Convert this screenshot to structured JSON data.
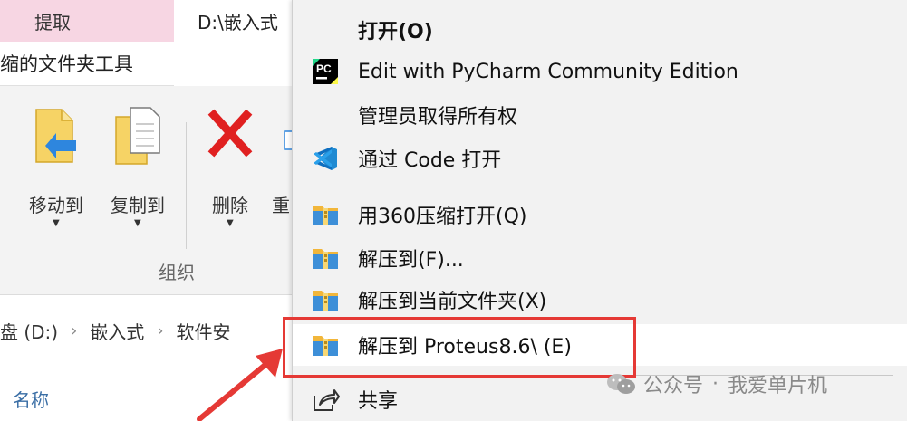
{
  "explorer": {
    "tab_extract": "提取",
    "tab_path": "D:\\嵌入式",
    "context_tools_label": "缩的文件夹工具",
    "ribbon": {
      "move_to": "移动到",
      "copy_to": "复制到",
      "delete": "删除",
      "rename_partial": "重",
      "group_label": "组织"
    },
    "address_bar": {
      "drive": "盘 (D:)",
      "crumb_1": "嵌入式",
      "crumb_2": "软件安"
    },
    "column_name": "名称"
  },
  "context_menu": {
    "items": [
      {
        "label": "打开(O)",
        "icon": "none",
        "bold": true
      },
      {
        "label": "Edit with PyCharm Community Edition",
        "icon": "pycharm-icon"
      },
      {
        "label": "管理员取得所有权",
        "icon": "none"
      },
      {
        "label": "通过 Code 打开",
        "icon": "vscode-icon"
      },
      {
        "label": "用360压缩打开(Q)",
        "icon": "archive-icon"
      },
      {
        "label": "解压到(F)...",
        "icon": "archive-icon"
      },
      {
        "label": "解压到当前文件夹(X)",
        "icon": "archive-icon"
      },
      {
        "label": "解压到 Proteus8.6\\ (E)",
        "icon": "archive-icon",
        "highlighted": true
      },
      {
        "label": "共享",
        "icon": "share-icon"
      }
    ]
  },
  "watermark": {
    "text_1": "公众号",
    "dot": "·",
    "text_2": "我爱单片机"
  },
  "colors": {
    "highlight_border": "#e53935",
    "arrow": "#e53935",
    "extract_tab_bg": "#f7d6e3"
  }
}
